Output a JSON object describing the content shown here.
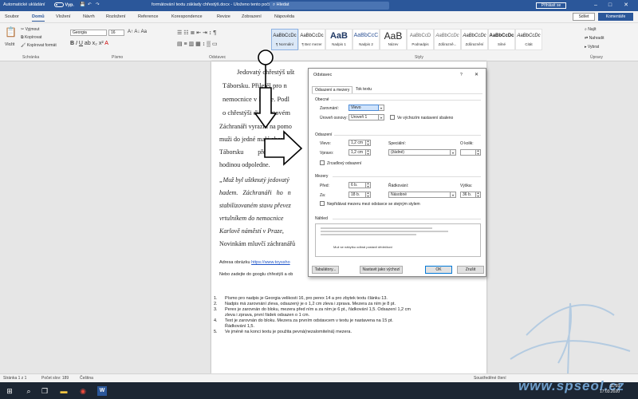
{
  "titlebar": {
    "autosave_label": "Automatické ukládání",
    "autosave_state": "Vyp.",
    "doc_title": "formátování textu základy chřestýš.docx - Uloženo tento počítač",
    "search_placeholder": "Hledat",
    "signin_label": "Přihlásit se",
    "min": "–",
    "max": "□",
    "close": "✕"
  },
  "menu": {
    "items": [
      "Soubor",
      "Domů",
      "Vložení",
      "Návrh",
      "Rozložení",
      "Reference",
      "Korespondence",
      "Revize",
      "Zobrazení",
      "Nápověda"
    ],
    "share": "Sdílet",
    "comments": "Komentáře"
  },
  "ribbon": {
    "clipboard": {
      "paste": "Vložit",
      "cut": "Vyjmout",
      "copy": "Kopírovat",
      "format_painter": "Kopírovat formát",
      "group": "Schránka"
    },
    "font": {
      "name": "Georgia",
      "size": "16",
      "group": "Písmo"
    },
    "paragraph": {
      "group": "Odstavec"
    },
    "styles": {
      "group": "Styly",
      "items": [
        {
          "preview": "AaBbCcDc",
          "name": "¶ Normální"
        },
        {
          "preview": "AaBbCcDc",
          "name": "¶ Bez mezer"
        },
        {
          "preview": "AaB",
          "name": "Nadpis 1"
        },
        {
          "preview": "AaBbCcC",
          "name": "Nadpis 2"
        },
        {
          "preview": "AaB",
          "name": "Název"
        },
        {
          "preview": "AaBbCcD",
          "name": "Podnadpis"
        },
        {
          "preview": "AaBbCcDc",
          "name": "Zdůrazně..."
        },
        {
          "preview": "AaBbCcDc",
          "name": "Zdůraznění"
        },
        {
          "preview": "AaBbCcDc",
          "name": "Silné"
        },
        {
          "preview": "AaBbCcDc",
          "name": "Citát"
        }
      ]
    },
    "editing": {
      "find": "Najít",
      "replace": "Nahradit",
      "select": "Vybrat",
      "group": "Úpravy"
    }
  },
  "document": {
    "heading_lines": [
      "Jedovatý chřestýš ušt",
      "Táborsku. Přiletěl pro n",
      "nemocnice v Praze. Podl",
      "o chřestýši diamantovém"
    ],
    "body_lines": [
      "Záchranáři vyrazili na pomo",
      "muži do jedné malé obce n",
      "Táborsku před čtvrt",
      "hodinou odpoledne."
    ],
    "quote_lines": [
      "„Muž byl uštknutý jedovatý",
      "hadem. Záchranáři ho n",
      "stabilizovaném stavu převez",
      "vrtulníkem do nemocnice",
      "Karlově náměstí v Praze,",
      "Novinkám mluvčí záchranářů"
    ],
    "image_addr_label": "Adresa obrázku",
    "image_addr_link": "https://www.toyssho",
    "google_line": "Nebo zadejte do googlu chřestýš a ob",
    "steps": [
      {
        "num": "1.",
        "text": "Písmo pro nadpis je Georgia velikosti 16, pro perex 14 a pro zbytek textu článku 13."
      },
      {
        "num": "2.",
        "text": "Nadpis má zarovnání zleva, odsazený je o 1,2 cm zleva i zprava. Mezera za ním je 8 pt."
      },
      {
        "num": "3.",
        "text": "Perex je zarovnán do bloku, mezera před ním a za ním je 6 pt., řádkování 1,5. Odsazení 1,2 cm"
      },
      {
        "num": "",
        "text": "zleva i zprava, první řádek odsazen o 1 cm."
      },
      {
        "num": "4.",
        "text": "Text je zarovnán do bloku. Mezera za prvním odstavcem v textu je nastavena na 15 pt."
      },
      {
        "num": "",
        "text": "Řádkování 1,5."
      },
      {
        "num": "5.",
        "text": "Ve jméně na konci textu je použita pevná(nezalomitelná) mezera."
      }
    ]
  },
  "dialog": {
    "title": "Odstavec",
    "help": "?",
    "close": "✕",
    "tabs": [
      "Odsazení a mezery",
      "Tok textu"
    ],
    "general": {
      "heading": "Obecné",
      "align_label": "Zarovnání:",
      "align_value": "Vlevo",
      "level_label": "Úroveň osnovy:",
      "level_value": "Úroveň 1",
      "collapsed_label": "Ve výchozím nastavení sbaleno"
    },
    "indent": {
      "heading": "Odsazení",
      "left_label": "Vlevo:",
      "left_value": "1,2 cm",
      "right_label": "Vpravo:",
      "right_value": "1,2 cm",
      "special_label": "Speciální:",
      "special_value": "(žádné)",
      "by_label": "O kolik:",
      "by_value": "",
      "mirror_label": "Zrcadlový odsazení"
    },
    "spacing": {
      "heading": "Mezery",
      "before_label": "Před:",
      "before_value": "6 b.",
      "after_label": "Za:",
      "after_value": "18 b.",
      "line_label": "Řádkování:",
      "line_value": "Násobné",
      "at_label": "Výška:",
      "at_value": "36 b.",
      "dont_add_label": "Nepřidávat mezeru mezi odstavce se stejným stylem"
    },
    "preview": {
      "heading": "Náhled",
      "sample": "Muž se nábytku odbral postavil dědečkovi"
    },
    "buttons": {
      "tabs": "Tabulátory...",
      "default": "Nastavit jako výchozí",
      "ok": "OK",
      "cancel": "Zrušit"
    }
  },
  "status": {
    "page": "Stránka 1 z 1",
    "words": "Počet slov: 189",
    "lang": "Čeština",
    "focus": "Soustředěné čtení"
  },
  "taskbar": {
    "time": "17:03.2020",
    "clock": "11:59"
  },
  "watermark": "www.spseol.cz",
  "colors": {
    "word_blue": "#2b579a",
    "heading_red": "#a0202a",
    "link": "#1f55c9"
  }
}
